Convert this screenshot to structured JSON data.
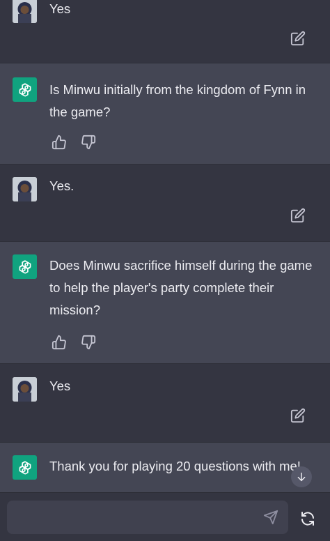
{
  "messages": [
    {
      "role": "user",
      "text": "Yes"
    },
    {
      "role": "assistant",
      "text": "Is Minwu initially from the kingdom of Fynn in the game?"
    },
    {
      "role": "user",
      "text": "Yes."
    },
    {
      "role": "assistant",
      "text": "Does Minwu sacrifice himself during the game to help the player's party complete their mission?"
    },
    {
      "role": "user",
      "text": "Yes"
    },
    {
      "role": "assistant",
      "text": "Thank you for playing 20 questions with me!"
    }
  ],
  "composer": {
    "placeholder": ""
  },
  "colors": {
    "background": "#343541",
    "assistant_bg": "#444654",
    "brand": "#10a37f",
    "input_bg": "#40414f"
  },
  "icons": [
    "user-avatar",
    "openai-logo-icon",
    "edit-icon",
    "thumbs-up-icon",
    "thumbs-down-icon",
    "send-icon",
    "regenerate-icon",
    "arrow-down-icon"
  ]
}
